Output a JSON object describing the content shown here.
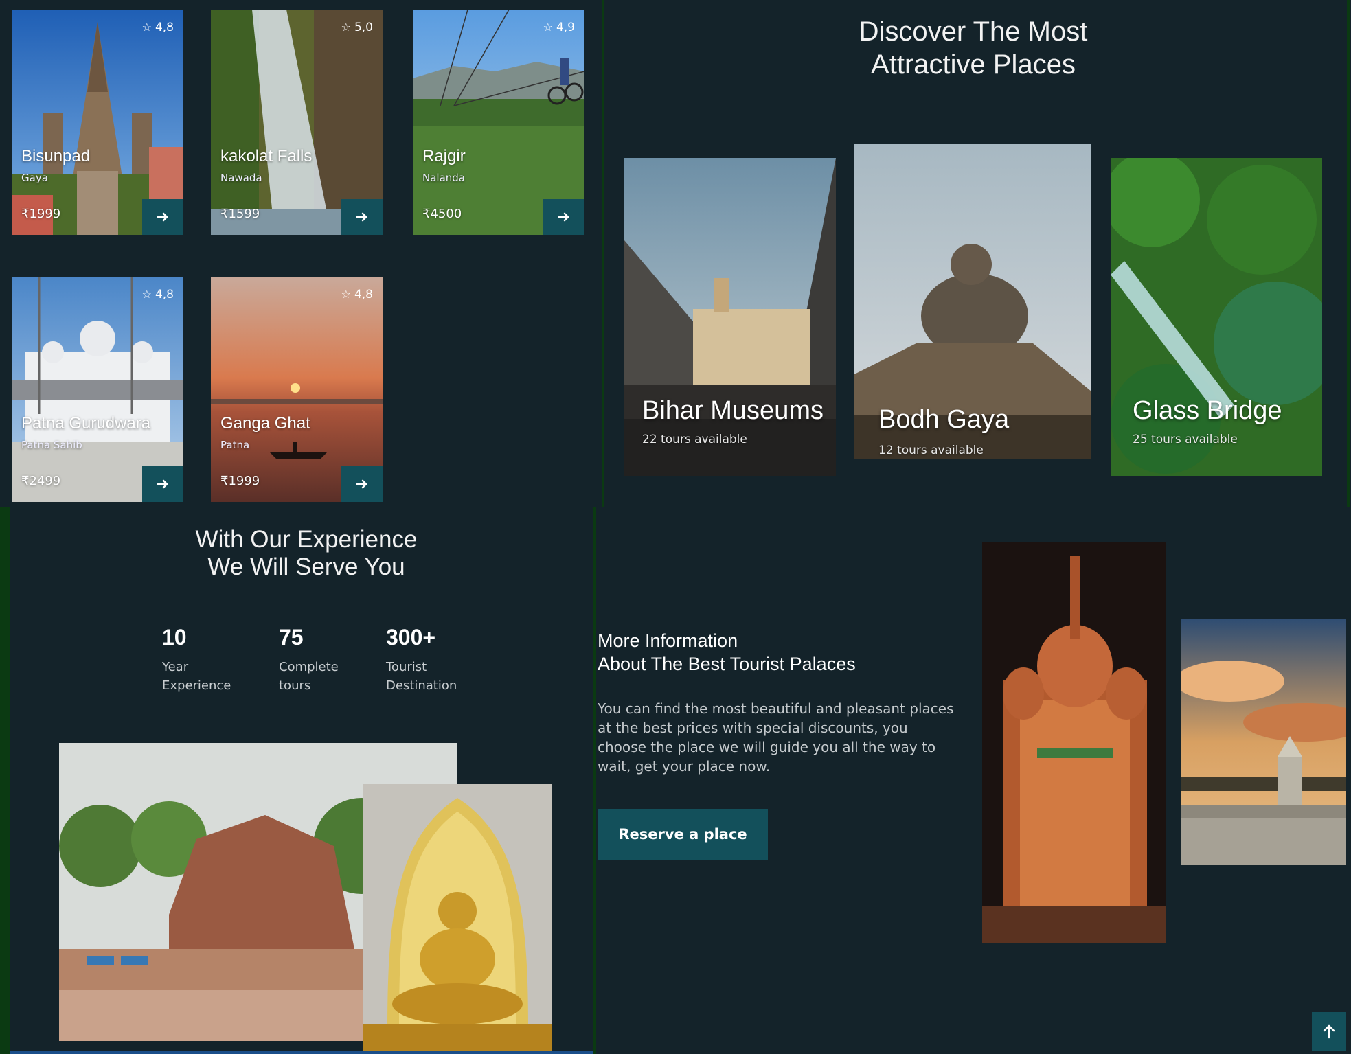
{
  "tours": [
    {
      "name": "Bisunpad",
      "location": "Gaya",
      "price": "₹1999",
      "rating": "4,8"
    },
    {
      "name": "kakolat Falls",
      "location": "Nawada",
      "price": "₹1599",
      "rating": "5,0"
    },
    {
      "name": "Rajgir",
      "location": "Nalanda",
      "price": "₹4500",
      "rating": "4,9"
    },
    {
      "name": "Patna Gurudwara",
      "location": "Patna Sahib",
      "price": "₹2499",
      "rating": "4,8"
    },
    {
      "name": "Ganga Ghat",
      "location": "Patna",
      "price": "₹1999",
      "rating": "4,8"
    }
  ],
  "discover": {
    "title_line1": "Discover The Most",
    "title_line2": "Attractive Places",
    "places": [
      {
        "name": "Bihar Museums",
        "tours": "22 tours available"
      },
      {
        "name": "Bodh Gaya",
        "tours": "12 tours available"
      },
      {
        "name": "Glass Bridge",
        "tours": "25 tours available"
      }
    ]
  },
  "experience": {
    "title_line1": "With Our Experience",
    "title_line2": "We Will Serve You",
    "stats": [
      {
        "value": "10",
        "label_line1": "Year",
        "label_line2": "Experience"
      },
      {
        "value": "75",
        "label_line1": "Complete",
        "label_line2": "tours"
      },
      {
        "value": "300+",
        "label_line1": "Tourist",
        "label_line2": "Destination"
      }
    ]
  },
  "info": {
    "title_line1": "More Information",
    "title_line2": "About The Best Tourist Palaces",
    "text": "You can find the most beautiful and pleasant places at the best prices with special discounts, you choose the place we will guide you all the way to wait, get your place now.",
    "button": "Reserve a place"
  },
  "colors": {
    "background": "#14232a",
    "accent": "#13505b"
  },
  "icons": {
    "rating": "star-icon",
    "card_action": "arrow-right-icon",
    "scroll_top": "arrow-up-icon"
  }
}
